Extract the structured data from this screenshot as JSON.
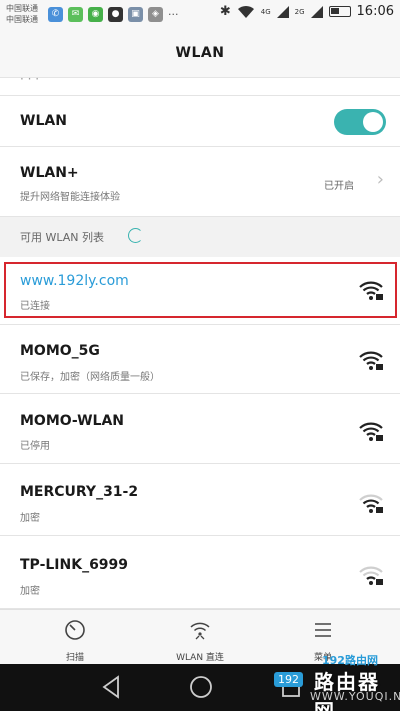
{
  "status_bar": {
    "carrier_1": "中国联通",
    "carrier_2": "中国联通",
    "network_1": "4G",
    "network_2": "2G",
    "time": "16:06",
    "app_icons": [
      "phone-icon",
      "chat-icon",
      "wechat-icon",
      "qq-icon",
      "gallery-icon",
      "mail-icon",
      "more-icon"
    ],
    "more": "···"
  },
  "header": {
    "title": "WLAN"
  },
  "partial_item": {
    "label": "· · ·"
  },
  "wlan_toggle": {
    "label": "WLAN",
    "enabled": true,
    "accent": "#3ab3b0"
  },
  "wlan_plus": {
    "label": "WLAN+",
    "subtitle": "提升网络智能连接体验",
    "status": "已开启"
  },
  "section": {
    "label": "可用 WLAN 列表"
  },
  "networks": [
    {
      "ssid": "www.192ly.com",
      "status": "已连接",
      "signal": 4,
      "secured": true,
      "connected": true,
      "color": "#2a9cd8"
    },
    {
      "ssid": "MOMO_5G",
      "status": "已保存，加密（网络质量一般）",
      "signal": 4,
      "secured": true
    },
    {
      "ssid": "MOMO-WLAN",
      "status": "已停用",
      "signal": 4,
      "secured": true
    },
    {
      "ssid": "MERCURY_31-2",
      "status": "加密",
      "signal": 3,
      "secured": true
    },
    {
      "ssid": "TP-LINK_6999",
      "status": "加密",
      "signal": 2,
      "secured": true
    }
  ],
  "highlight_color": "#d6262e",
  "bottom_nav": [
    {
      "label": "扫描",
      "icon": "scan-icon"
    },
    {
      "label": "WLAN 直连",
      "icon": "wifi-direct-icon"
    },
    {
      "label": "菜单",
      "icon": "menu-icon"
    }
  ],
  "system_nav": [
    "back-icon",
    "home-icon",
    "recents-icon"
  ],
  "watermark": {
    "top": "192路由网",
    "main": "路由器网",
    "bottom": "WWW.YOUQI.NET",
    "logo": "192"
  }
}
